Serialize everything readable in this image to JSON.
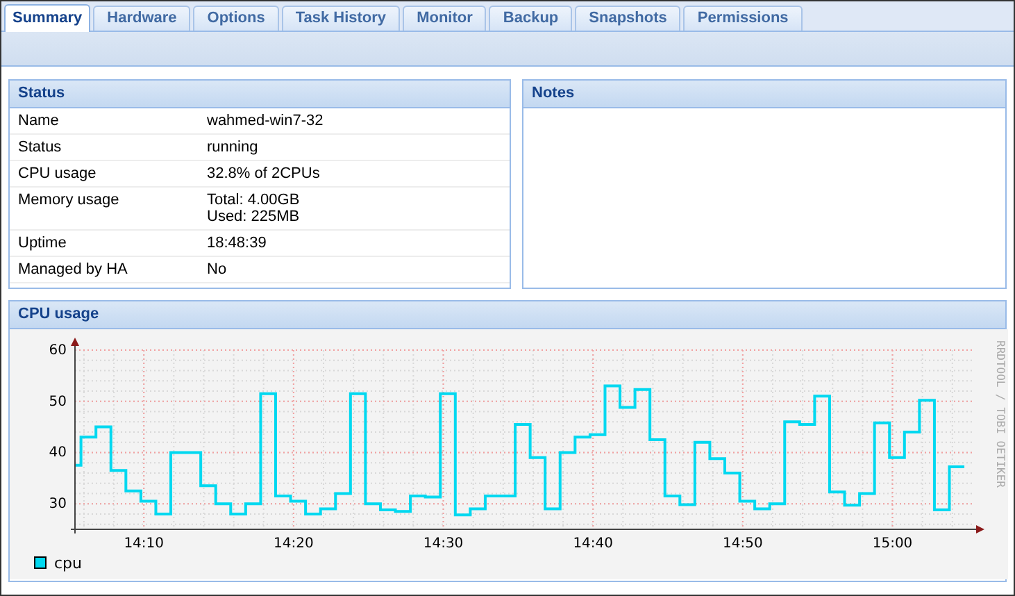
{
  "tabs": [
    {
      "label": "Summary",
      "selected": true
    },
    {
      "label": "Hardware",
      "selected": false
    },
    {
      "label": "Options",
      "selected": false
    },
    {
      "label": "Task History",
      "selected": false
    },
    {
      "label": "Monitor",
      "selected": false
    },
    {
      "label": "Backup",
      "selected": false
    },
    {
      "label": "Snapshots",
      "selected": false
    },
    {
      "label": "Permissions",
      "selected": false
    }
  ],
  "status": {
    "title": "Status",
    "rows": [
      {
        "label": "Name",
        "value": [
          "wahmed-win7-32"
        ]
      },
      {
        "label": "Status",
        "value": [
          "running"
        ]
      },
      {
        "label": "CPU usage",
        "value": [
          "32.8% of 2CPUs"
        ]
      },
      {
        "label": "Memory usage",
        "value": [
          "Total: 4.00GB",
          "Used: 225MB"
        ]
      },
      {
        "label": "Uptime",
        "value": [
          "18:48:39"
        ]
      },
      {
        "label": "Managed by HA",
        "value": [
          "No"
        ]
      }
    ]
  },
  "notes": {
    "title": "Notes"
  },
  "cpu_panel": {
    "title": "CPU usage",
    "credit": "RRDTOOL / TOBI OETIKER",
    "chart_data": {
      "type": "line",
      "x": [
        845.4,
        845.8,
        845.8,
        846.8,
        846.8,
        847.8,
        847.8,
        848.8,
        848.8,
        849.8,
        849.8,
        850.8,
        850.8,
        851.8,
        851.8,
        852.8,
        852.8,
        853.8,
        853.8,
        854.8,
        854.8,
        855.8,
        855.8,
        856.8,
        856.8,
        857.8,
        857.8,
        858.8,
        858.8,
        859.8,
        859.8,
        860.8,
        860.8,
        861.8,
        861.8,
        862.8,
        862.8,
        863.8,
        863.8,
        864.8,
        864.8,
        865.8,
        865.8,
        866.8,
        866.8,
        867.8,
        867.8,
        868.8,
        868.8,
        869.8,
        869.8,
        870.8,
        870.8,
        871.8,
        871.8,
        872.8,
        872.8,
        873.8,
        873.8,
        874.8,
        874.8,
        875.8,
        875.8,
        876.8,
        876.8,
        877.8,
        877.8,
        878.8,
        878.8,
        879.8,
        879.8,
        880.8,
        880.8,
        881.8,
        881.8,
        882.8,
        882.8,
        883.8,
        883.8,
        884.8,
        884.8,
        885.8,
        885.8,
        886.8,
        886.8,
        887.8,
        887.8,
        888.8,
        888.8,
        889.8,
        889.8,
        890.8,
        890.8,
        891.8,
        891.8,
        892.8,
        892.8,
        893.8,
        893.8,
        894.8,
        894.8,
        895.8,
        895.8,
        896.8,
        896.8,
        897.8,
        897.8,
        898.8,
        898.8,
        899.8,
        899.8,
        900.8,
        900.8,
        901.8,
        901.8,
        902.8,
        902.8,
        903.8,
        903.8,
        904.8
      ],
      "series": [
        {
          "name": "cpu",
          "color": "#00d8f0",
          "values": [
            37.5,
            37.5,
            43,
            43,
            45,
            45,
            36.5,
            36.5,
            32.5,
            32.5,
            30.5,
            30.5,
            28,
            28,
            40,
            40,
            40,
            40,
            33.5,
            33.5,
            30,
            30,
            28,
            28,
            30,
            30,
            51.5,
            51.5,
            31.5,
            31.5,
            30.5,
            30.5,
            28,
            28,
            29,
            29,
            32,
            32,
            51.5,
            51.5,
            30,
            30,
            28.8,
            28.8,
            28.5,
            28.5,
            31.5,
            31.5,
            31.3,
            31.3,
            51.5,
            51.5,
            27.8,
            27.8,
            29,
            29,
            31.5,
            31.5,
            31.5,
            31.5,
            45.5,
            45.5,
            39,
            39,
            29,
            29,
            40,
            40,
            43,
            43,
            43.5,
            43.5,
            53,
            53,
            48.8,
            48.8,
            52.3,
            52.3,
            42.5,
            42.5,
            31.5,
            31.5,
            29.8,
            29.8,
            42,
            42,
            38.8,
            38.8,
            36,
            36,
            30.5,
            30.5,
            29,
            29,
            30,
            30,
            46,
            46,
            45.5,
            45.5,
            51,
            51,
            32.3,
            32.3,
            29.7,
            29.7,
            32,
            32,
            45.8,
            45.8,
            39,
            39,
            44,
            44,
            50.2,
            50.2,
            28.8,
            28.8,
            37.2,
            37.2
          ]
        }
      ],
      "xlim": [
        845.4,
        905.4
      ],
      "ylim": [
        25,
        60
      ],
      "grid": true,
      "xticks": [
        {
          "value": 850,
          "label": "14:10"
        },
        {
          "value": 860,
          "label": "14:20"
        },
        {
          "value": 870,
          "label": "14:30"
        },
        {
          "value": 880,
          "label": "14:40"
        },
        {
          "value": 890,
          "label": "14:50"
        },
        {
          "value": 900,
          "label": "15:00"
        }
      ],
      "yticks": [
        30,
        40,
        50,
        60
      ]
    }
  }
}
